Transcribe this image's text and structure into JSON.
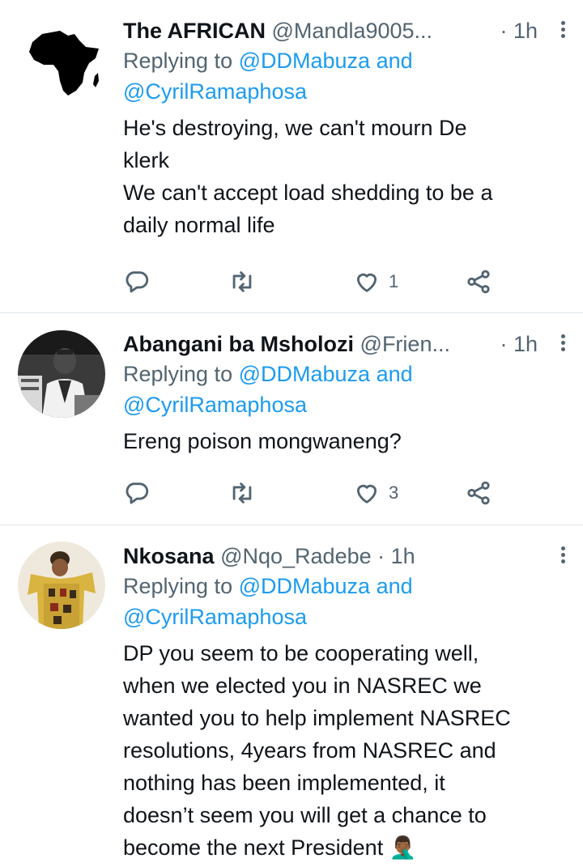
{
  "tweets": [
    {
      "name": "The AFRICAN",
      "handle": "@Mandla9005...",
      "time": "· 1h",
      "replying_prefix": "Replying to",
      "replying_to_1": "@DDMabuza",
      "replying_and": "and",
      "replying_to_2": "@CyrilRamaphosa",
      "text": "He's destroying,  we can't mourn De\nklerk\nWe can't accept load shedding to be a\ndaily normal life",
      "likes": "1"
    },
    {
      "name": "Abangani ba Msholozi",
      "handle": "@Frien...",
      "time": "· 1h",
      "replying_prefix": "Replying to",
      "replying_to_1": "@DDMabuza",
      "replying_and": "and",
      "replying_to_2": "@CyrilRamaphosa",
      "text": "Ereng poison mongwaneng?",
      "likes": "3"
    },
    {
      "name": "Nkosana",
      "handle": "@Nqo_Radebe",
      "time": "· 1h",
      "replying_prefix": "Replying to",
      "replying_to_1": "@DDMabuza",
      "replying_and": "and",
      "replying_to_2": "@CyrilRamaphosa",
      "text": "DP you seem to be cooperating well,\nwhen we elected you in NASREC we\nwanted you to help implement NASREC\nresolutions, 4years from NASREC and\nnothing has been implemented, it\ndoesn’t seem you will get a chance to\nbecome the next President 🤦🏾‍♂️"
    }
  ],
  "icons": {
    "reply": "reply-icon",
    "retweet": "retweet-icon",
    "like": "heart-icon",
    "share": "share-icon",
    "more": "more-options-icon"
  },
  "colors": {
    "accent": "#1d9bf0",
    "muted": "#536471",
    "text": "#0f1419",
    "divider": "#e1e6ea"
  }
}
